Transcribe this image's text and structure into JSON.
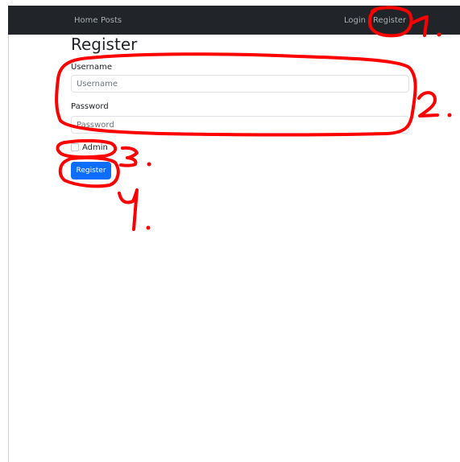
{
  "navbar": {
    "left_links": [
      {
        "label": "Home"
      },
      {
        "label": "Posts"
      }
    ],
    "right_links": [
      {
        "label": "Login"
      },
      {
        "label": "Register"
      }
    ]
  },
  "form": {
    "title": "Register",
    "username_label": "Username",
    "username_placeholder": "Username",
    "username_value": "",
    "password_label": "Password",
    "password_placeholder": "Password",
    "password_value": "",
    "admin_label": "Admin",
    "admin_checked": false,
    "submit_label": "Register"
  },
  "annotations": {
    "color": "#ff0000",
    "markers": [
      "1.",
      "2.",
      "3.",
      "4."
    ]
  },
  "colors": {
    "navbar_bg": "#212529",
    "nav_link": "#a9aeb3",
    "primary": "#0d6efd"
  }
}
